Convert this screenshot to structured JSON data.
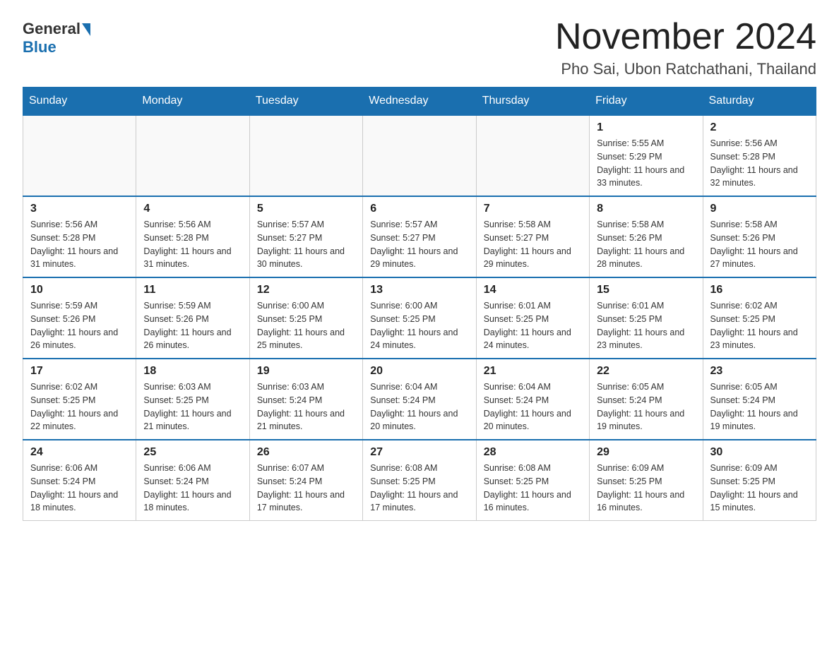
{
  "header": {
    "logo_general": "General",
    "logo_blue": "Blue",
    "month_title": "November 2024",
    "location": "Pho Sai, Ubon Ratchathani, Thailand"
  },
  "days_of_week": [
    "Sunday",
    "Monday",
    "Tuesday",
    "Wednesday",
    "Thursday",
    "Friday",
    "Saturday"
  ],
  "weeks": [
    [
      {
        "day": "",
        "info": ""
      },
      {
        "day": "",
        "info": ""
      },
      {
        "day": "",
        "info": ""
      },
      {
        "day": "",
        "info": ""
      },
      {
        "day": "",
        "info": ""
      },
      {
        "day": "1",
        "info": "Sunrise: 5:55 AM\nSunset: 5:29 PM\nDaylight: 11 hours and 33 minutes."
      },
      {
        "day": "2",
        "info": "Sunrise: 5:56 AM\nSunset: 5:28 PM\nDaylight: 11 hours and 32 minutes."
      }
    ],
    [
      {
        "day": "3",
        "info": "Sunrise: 5:56 AM\nSunset: 5:28 PM\nDaylight: 11 hours and 31 minutes."
      },
      {
        "day": "4",
        "info": "Sunrise: 5:56 AM\nSunset: 5:28 PM\nDaylight: 11 hours and 31 minutes."
      },
      {
        "day": "5",
        "info": "Sunrise: 5:57 AM\nSunset: 5:27 PM\nDaylight: 11 hours and 30 minutes."
      },
      {
        "day": "6",
        "info": "Sunrise: 5:57 AM\nSunset: 5:27 PM\nDaylight: 11 hours and 29 minutes."
      },
      {
        "day": "7",
        "info": "Sunrise: 5:58 AM\nSunset: 5:27 PM\nDaylight: 11 hours and 29 minutes."
      },
      {
        "day": "8",
        "info": "Sunrise: 5:58 AM\nSunset: 5:26 PM\nDaylight: 11 hours and 28 minutes."
      },
      {
        "day": "9",
        "info": "Sunrise: 5:58 AM\nSunset: 5:26 PM\nDaylight: 11 hours and 27 minutes."
      }
    ],
    [
      {
        "day": "10",
        "info": "Sunrise: 5:59 AM\nSunset: 5:26 PM\nDaylight: 11 hours and 26 minutes."
      },
      {
        "day": "11",
        "info": "Sunrise: 5:59 AM\nSunset: 5:26 PM\nDaylight: 11 hours and 26 minutes."
      },
      {
        "day": "12",
        "info": "Sunrise: 6:00 AM\nSunset: 5:25 PM\nDaylight: 11 hours and 25 minutes."
      },
      {
        "day": "13",
        "info": "Sunrise: 6:00 AM\nSunset: 5:25 PM\nDaylight: 11 hours and 24 minutes."
      },
      {
        "day": "14",
        "info": "Sunrise: 6:01 AM\nSunset: 5:25 PM\nDaylight: 11 hours and 24 minutes."
      },
      {
        "day": "15",
        "info": "Sunrise: 6:01 AM\nSunset: 5:25 PM\nDaylight: 11 hours and 23 minutes."
      },
      {
        "day": "16",
        "info": "Sunrise: 6:02 AM\nSunset: 5:25 PM\nDaylight: 11 hours and 23 minutes."
      }
    ],
    [
      {
        "day": "17",
        "info": "Sunrise: 6:02 AM\nSunset: 5:25 PM\nDaylight: 11 hours and 22 minutes."
      },
      {
        "day": "18",
        "info": "Sunrise: 6:03 AM\nSunset: 5:25 PM\nDaylight: 11 hours and 21 minutes."
      },
      {
        "day": "19",
        "info": "Sunrise: 6:03 AM\nSunset: 5:24 PM\nDaylight: 11 hours and 21 minutes."
      },
      {
        "day": "20",
        "info": "Sunrise: 6:04 AM\nSunset: 5:24 PM\nDaylight: 11 hours and 20 minutes."
      },
      {
        "day": "21",
        "info": "Sunrise: 6:04 AM\nSunset: 5:24 PM\nDaylight: 11 hours and 20 minutes."
      },
      {
        "day": "22",
        "info": "Sunrise: 6:05 AM\nSunset: 5:24 PM\nDaylight: 11 hours and 19 minutes."
      },
      {
        "day": "23",
        "info": "Sunrise: 6:05 AM\nSunset: 5:24 PM\nDaylight: 11 hours and 19 minutes."
      }
    ],
    [
      {
        "day": "24",
        "info": "Sunrise: 6:06 AM\nSunset: 5:24 PM\nDaylight: 11 hours and 18 minutes."
      },
      {
        "day": "25",
        "info": "Sunrise: 6:06 AM\nSunset: 5:24 PM\nDaylight: 11 hours and 18 minutes."
      },
      {
        "day": "26",
        "info": "Sunrise: 6:07 AM\nSunset: 5:24 PM\nDaylight: 11 hours and 17 minutes."
      },
      {
        "day": "27",
        "info": "Sunrise: 6:08 AM\nSunset: 5:25 PM\nDaylight: 11 hours and 17 minutes."
      },
      {
        "day": "28",
        "info": "Sunrise: 6:08 AM\nSunset: 5:25 PM\nDaylight: 11 hours and 16 minutes."
      },
      {
        "day": "29",
        "info": "Sunrise: 6:09 AM\nSunset: 5:25 PM\nDaylight: 11 hours and 16 minutes."
      },
      {
        "day": "30",
        "info": "Sunrise: 6:09 AM\nSunset: 5:25 PM\nDaylight: 11 hours and 15 minutes."
      }
    ]
  ]
}
